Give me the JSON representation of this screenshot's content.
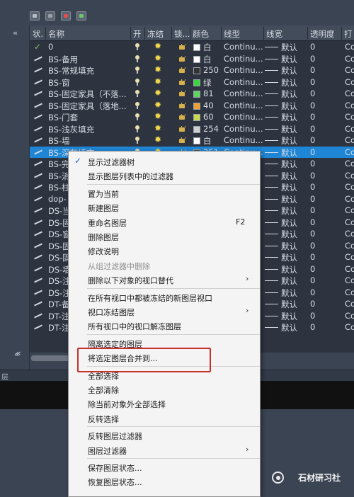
{
  "toolbar": {
    "icons": [
      "layer-filter-new-icon",
      "layer-filter-group-icon",
      "layer-delete-icon",
      "layer-current-icon"
    ]
  },
  "columns": {
    "status": "状.",
    "name": "名称",
    "on": "开",
    "freeze": "冻结",
    "lock": "锁...",
    "color": "颜色",
    "linetype": "线型",
    "lineweight": "线宽",
    "transparency": "透明度",
    "plot": "打"
  },
  "rows": [
    {
      "status": "current",
      "name": "0",
      "color_name": "白",
      "color": "#ffffff",
      "linetype": "Continu...",
      "lineweight": "默认",
      "transparency": "0",
      "plot": "Co"
    },
    {
      "status": "layer",
      "name": "BS-备用",
      "color_name": "白",
      "color": "#ffffff",
      "linetype": "Continu...",
      "lineweight": "默认",
      "transparency": "0",
      "plot": "Co"
    },
    {
      "status": "layer",
      "name": "BS-常规填充",
      "color_name": "250",
      "color": "#333333",
      "linetype": "Continu...",
      "lineweight": "默认",
      "transparency": "0",
      "plot": "Co"
    },
    {
      "status": "layer",
      "name": "BS-窗",
      "color_name": "绿",
      "color": "#3fd33f",
      "linetype": "Continu...",
      "lineweight": "默认",
      "transparency": "0",
      "plot": "Co"
    },
    {
      "status": "layer",
      "name": "BS-固定家具（不落...",
      "color_name": "81",
      "color": "#5cd65c",
      "linetype": "Continu...",
      "lineweight": "默认",
      "transparency": "0",
      "plot": "Co"
    },
    {
      "status": "layer",
      "name": "BS-固定家具（落地...",
      "color_name": "40",
      "color": "#f0a030",
      "linetype": "Continu...",
      "lineweight": "默认",
      "transparency": "0",
      "plot": "Co"
    },
    {
      "status": "layer",
      "name": "BS-门套",
      "color_name": "60",
      "color": "#c8d84a",
      "linetype": "Continu...",
      "lineweight": "默认",
      "transparency": "0",
      "plot": "Co"
    },
    {
      "status": "layer",
      "name": "BS-浅灰填充",
      "color_name": "254",
      "color": "#cfcfcf",
      "linetype": "Continu...",
      "lineweight": "默认",
      "transparency": "0",
      "plot": "Co"
    },
    {
      "status": "layer",
      "name": "BS-墙",
      "color_name": "白",
      "color": "#ffffff",
      "linetype": "Continu...",
      "lineweight": "默认",
      "transparency": "0",
      "plot": "Co"
    },
    {
      "status": "layer",
      "name": "BS-深灰填充",
      "color_name": "251",
      "color": "#555555",
      "linetype": "Continu...",
      "lineweight": "默认",
      "transparency": "0",
      "plot": "Co"
    },
    {
      "status": "layer",
      "name": "BS-完",
      "color_name": "",
      "color": "#ffffff",
      "linetype": "",
      "lineweight": "默认",
      "transparency": "0",
      "plot": "Co"
    },
    {
      "status": "layer",
      "name": "BS-消",
      "color_name": "",
      "color": "#ffffff",
      "linetype": "",
      "lineweight": "默认",
      "transparency": "0",
      "plot": "Co"
    },
    {
      "status": "layer",
      "name": "BS-柱",
      "color_name": "",
      "color": "#ffffff",
      "linetype": "",
      "lineweight": "默认",
      "transparency": "0",
      "plot": "Co"
    },
    {
      "status": "layer",
      "name": "dop-",
      "color_name": "",
      "color": "#ffffff",
      "linetype": "",
      "lineweight": "默认",
      "transparency": "0",
      "plot": "Co"
    },
    {
      "status": "layer",
      "name": "DS-当",
      "color_name": "",
      "color": "#ffffff",
      "linetype": "",
      "lineweight": "默认",
      "transparency": "0",
      "plot": "Co"
    },
    {
      "status": "layer",
      "name": "DS-固",
      "color_name": "",
      "color": "#ffffff",
      "linetype": "",
      "lineweight": "默认",
      "transparency": "0",
      "plot": "Co"
    },
    {
      "status": "layer",
      "name": "DS-窗",
      "color_name": "",
      "color": "#ffffff",
      "linetype": "",
      "lineweight": "默认",
      "transparency": "0",
      "plot": "Co"
    },
    {
      "status": "layer",
      "name": "DS-固",
      "color_name": "",
      "color": "#ffffff",
      "linetype": "",
      "lineweight": "默认",
      "transparency": "0",
      "plot": "Co"
    },
    {
      "status": "layer",
      "name": "DS-固",
      "color_name": "",
      "color": "#ffffff",
      "linetype": "",
      "lineweight": "默认",
      "transparency": "0",
      "plot": "Co"
    },
    {
      "status": "layer",
      "name": "DS-墙",
      "color_name": "",
      "color": "#ffffff",
      "linetype": "",
      "lineweight": "默认",
      "transparency": "0",
      "plot": "Co"
    },
    {
      "status": "layer",
      "name": "DS-注",
      "color_name": "",
      "color": "#ffffff",
      "linetype": "",
      "lineweight": "默认",
      "transparency": "0",
      "plot": "Co"
    },
    {
      "status": "layer",
      "name": "DS-注",
      "color_name": "",
      "color": "#ffffff",
      "linetype": "",
      "lineweight": "默认",
      "transparency": "0",
      "plot": "Co"
    },
    {
      "status": "layer",
      "name": "DT-备",
      "color_name": "",
      "color": "#ffffff",
      "linetype": "",
      "lineweight": "默认",
      "transparency": "0",
      "plot": "Co"
    },
    {
      "status": "layer",
      "name": "DT-注",
      "color_name": "",
      "color": "#ffffff",
      "linetype": "",
      "lineweight": "默认",
      "transparency": "0",
      "plot": "Co"
    },
    {
      "status": "layer",
      "name": "DT-注",
      "color_name": "",
      "color": "#ffffff",
      "linetype": "",
      "lineweight": "默认",
      "transparency": "0",
      "plot": "Co"
    }
  ],
  "selected_row": 9,
  "statusbar": {
    "text": "层"
  },
  "menu": [
    {
      "label": "显示过滤器树",
      "checked": true
    },
    {
      "label": "显示图层列表中的过滤器"
    },
    {
      "sep": true
    },
    {
      "label": "置为当前"
    },
    {
      "label": "新建图层"
    },
    {
      "label": "重命名图层",
      "shortcut": "F2"
    },
    {
      "label": "删除图层"
    },
    {
      "label": "修改说明"
    },
    {
      "label": "从组过滤器中删除",
      "disabled": true
    },
    {
      "label": "删除以下对象的视口替代",
      "submenu": true
    },
    {
      "sep": true
    },
    {
      "label": "在所有视口中都被冻结的新图层视口"
    },
    {
      "label": "视口冻结图层",
      "submenu": true
    },
    {
      "label": "所有视口中的视口解冻图层"
    },
    {
      "sep": true
    },
    {
      "label": "隔离选定的图层"
    },
    {
      "label": "将选定图层合并到..."
    },
    {
      "sep": true
    },
    {
      "label": "全部选择"
    },
    {
      "label": "全部清除"
    },
    {
      "label": "除当前对象外全部选择"
    },
    {
      "label": "反转选择"
    },
    {
      "sep": true
    },
    {
      "label": "反转图层过滤器"
    },
    {
      "label": "图层过滤器",
      "submenu": true
    },
    {
      "sep": true
    },
    {
      "label": "保存图层状态..."
    },
    {
      "label": "恢复图层状态..."
    }
  ],
  "watermark": {
    "text": "石材研习社",
    "logo_icon": "wechat-logo-icon"
  },
  "colors": {
    "selection": "#1f86d6",
    "highlight_box": "#c9302c",
    "panel_bg": "#3b4453"
  }
}
